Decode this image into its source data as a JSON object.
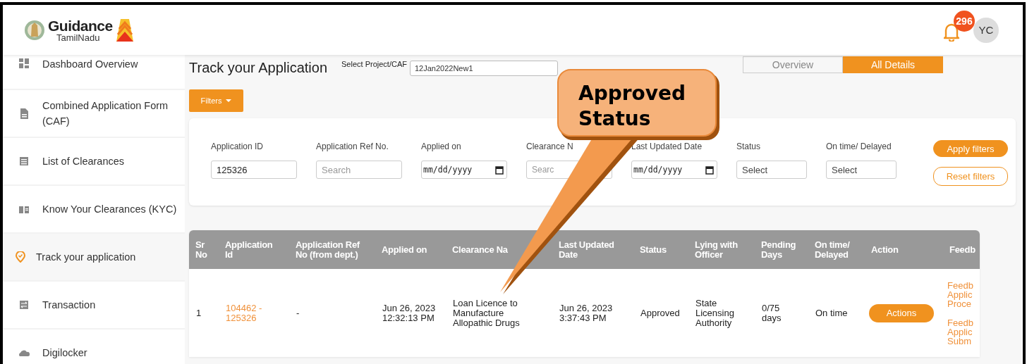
{
  "header": {
    "logo": {
      "title": "Guidance",
      "subtitle": "TamilNadu"
    },
    "notification_count": "296",
    "avatar": "YC"
  },
  "sidebar": {
    "items": [
      {
        "label": "Dashboard Overview",
        "selected": false
      },
      {
        "label": "Combined Application Form (CAF)",
        "selected": false
      },
      {
        "label": "List of Clearances",
        "selected": false
      },
      {
        "label": "Know Your Clearances (KYC)",
        "selected": false
      },
      {
        "label": "Track your application",
        "selected": true
      },
      {
        "label": "Transaction",
        "selected": false
      },
      {
        "label": "Digilocker",
        "selected": false
      }
    ]
  },
  "page": {
    "title": "Track your Application",
    "project_label": "Select Project/CAF",
    "project_value": "12Jan2022New1",
    "view_tabs": [
      {
        "label": "Overview",
        "selected": false
      },
      {
        "label": "All Details",
        "selected": true
      }
    ],
    "filters_button": "Filters"
  },
  "filters": {
    "fields": [
      {
        "label": "Application ID",
        "kind": "text",
        "value": "125326"
      },
      {
        "label": "Application Ref No.",
        "kind": "text",
        "placeholder": "Search"
      },
      {
        "label": "Applied on",
        "kind": "date",
        "placeholder": "mm/dd/yyyy"
      },
      {
        "label": "Clearance N",
        "kind": "text",
        "placeholder": "Searc"
      },
      {
        "label": "Last Updated Date",
        "kind": "date",
        "placeholder": "mm/dd/yyyy"
      },
      {
        "label": "Status",
        "kind": "select",
        "value": "Select"
      },
      {
        "label": "On time/ Delayed",
        "kind": "select",
        "value": "Select"
      }
    ],
    "apply_button": "Apply filters",
    "reset_button": "Reset filters"
  },
  "table": {
    "columns": [
      "Sr\nNo",
      "Application\nId",
      "Application Ref\nNo (from dept.)",
      "Applied on",
      "Clearance Na",
      "Last Updated\nDate",
      "Status",
      "Lying with\nOfficer",
      "Pending\nDays",
      "On time/\nDelayed",
      "Action",
      "Feedb"
    ],
    "rows": [
      {
        "cells": [
          {
            "kind": "text",
            "text": "1"
          },
          {
            "kind": "link",
            "text": "104462 -\n125326"
          },
          {
            "kind": "text",
            "text": "-"
          },
          {
            "kind": "text",
            "text": "Jun 26, 2023\n12:32:13 PM"
          },
          {
            "kind": "text",
            "text": "Loan Licence to\nManufacture\nAllopathic Drugs"
          },
          {
            "kind": "text",
            "text": "Jun 26, 2023\n3:37:43 PM"
          },
          {
            "kind": "text",
            "text": "Approved"
          },
          {
            "kind": "text",
            "text": "State\nLicensing\nAuthority"
          },
          {
            "kind": "text",
            "text": "0/75\ndays"
          },
          {
            "kind": "text",
            "text": "On time"
          },
          {
            "kind": "button",
            "text": "Actions"
          },
          {
            "kind": "links",
            "links": [
              "Feedb\nApplic\nProce",
              "Feedb\nApplic\nSubm"
            ]
          }
        ]
      }
    ]
  },
  "callout": {
    "text": "Approved\nStatus"
  }
}
